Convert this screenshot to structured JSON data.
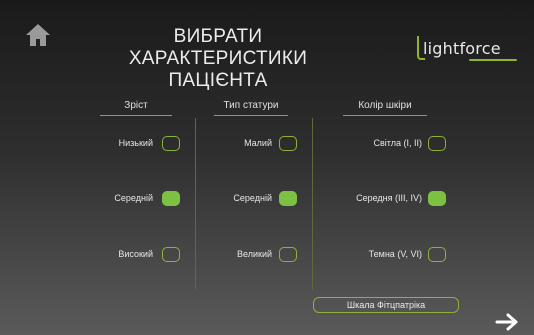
{
  "header": {
    "title_line1": "ВИБРАТИ ХАРАКТЕРИСТИКИ",
    "title_line2": "ПАЦІЄНТА",
    "logo_text": "lightforce"
  },
  "columns": {
    "height": {
      "label": "Зріст",
      "options": [
        {
          "label": "Низький",
          "selected": false
        },
        {
          "label": "Середній",
          "selected": true
        },
        {
          "label": "Високий",
          "selected": false
        }
      ]
    },
    "build": {
      "label": "Тип статури",
      "options": [
        {
          "label": "Малий",
          "selected": false
        },
        {
          "label": "Середній",
          "selected": true
        },
        {
          "label": "Великий",
          "selected": false
        }
      ]
    },
    "skin": {
      "label": "Колір шкіри",
      "options": [
        {
          "label": "Світла (I, II)",
          "selected": false
        },
        {
          "label": "Середня (III, IV)",
          "selected": true
        },
        {
          "label": "Темна (V, VI)",
          "selected": false
        }
      ]
    }
  },
  "footer": {
    "scale_button": "Шкала Фітцпатріка"
  },
  "icons": {
    "home": "home-icon",
    "next": "arrow-right-icon"
  },
  "colors": {
    "accent_green": "#7cc142",
    "outline_green": "#8bb33a"
  }
}
